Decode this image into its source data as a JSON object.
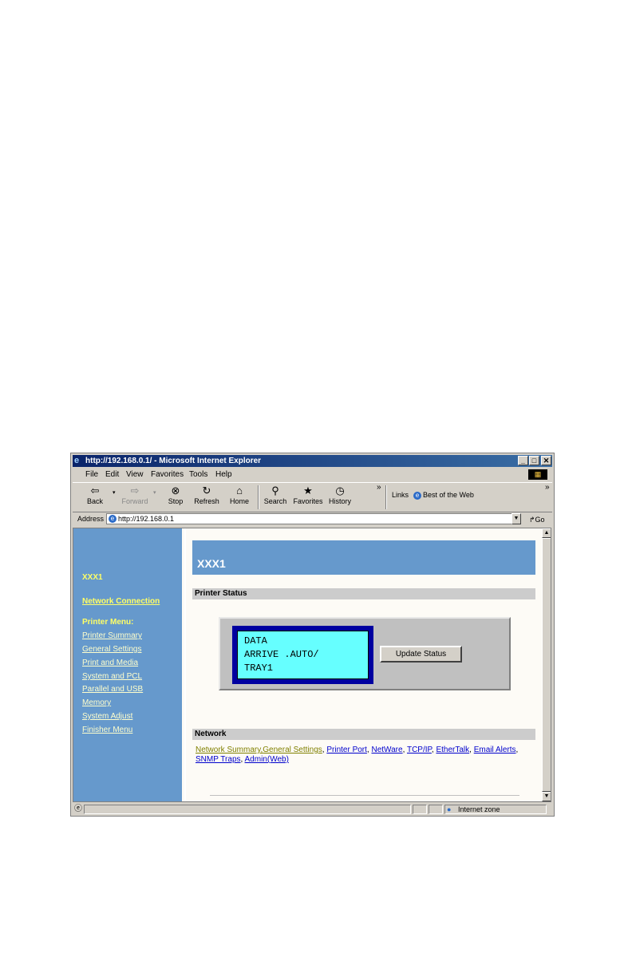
{
  "window": {
    "title": "http://192.168.0.1/ - Microsoft Internet Explorer",
    "minimize": "_",
    "maximize": "□",
    "close": "✕"
  },
  "menu": [
    "File",
    "Edit",
    "View",
    "Favorites",
    "Tools",
    "Help"
  ],
  "toolbar": {
    "back": "Back",
    "forward": "Forward",
    "stop": "Stop",
    "refresh": "Refresh",
    "home": "Home",
    "search": "Search",
    "favorites": "Favorites",
    "history": "History",
    "links_label": "Links",
    "best_of_web": "Best of the Web",
    "chevron": "»"
  },
  "address": {
    "label": "Address",
    "url": "http://192.168.0.1",
    "go": "Go"
  },
  "sidebar": {
    "device": "XXX1",
    "network_connection": "Network Connection",
    "printer_menu": "Printer Menu:",
    "items": [
      "Printer Summary",
      "General Settings",
      "Print and Media",
      "System and PCL",
      "Parallel and USB",
      "Memory",
      "System Adjust",
      "Finisher Menu"
    ]
  },
  "main": {
    "banner": "XXX1",
    "printer_status_heading": "Printer Status",
    "display_lines": [
      "DATA",
      "ARRIVE .AUTO/",
      "TRAY1"
    ],
    "update_button": "Update Status",
    "network_heading": "Network",
    "network_links": [
      "Network Summary",
      "General Settings",
      "Printer Port",
      "NetWare",
      "TCP/IP",
      "EtherTalk",
      "Email Alerts",
      "SNMP Traps",
      "Admin(Web)"
    ]
  },
  "status_bar": {
    "zone": "Internet zone"
  },
  "icons": {
    "back": "arrow-left-icon",
    "forward": "arrow-right-icon",
    "stop": "stop-icon",
    "refresh": "refresh-icon",
    "home": "home-icon",
    "search": "search-icon",
    "favorites": "favorites-icon",
    "history": "history-icon",
    "ie": "ie-logo-icon",
    "globe": "globe-icon"
  },
  "colors": {
    "sidebar": "#6699cc",
    "banner": "#6699cc",
    "lcd": "#66ffff",
    "lcd_frame": "#0000a0",
    "sidebar_highlight": "#ffff66"
  }
}
